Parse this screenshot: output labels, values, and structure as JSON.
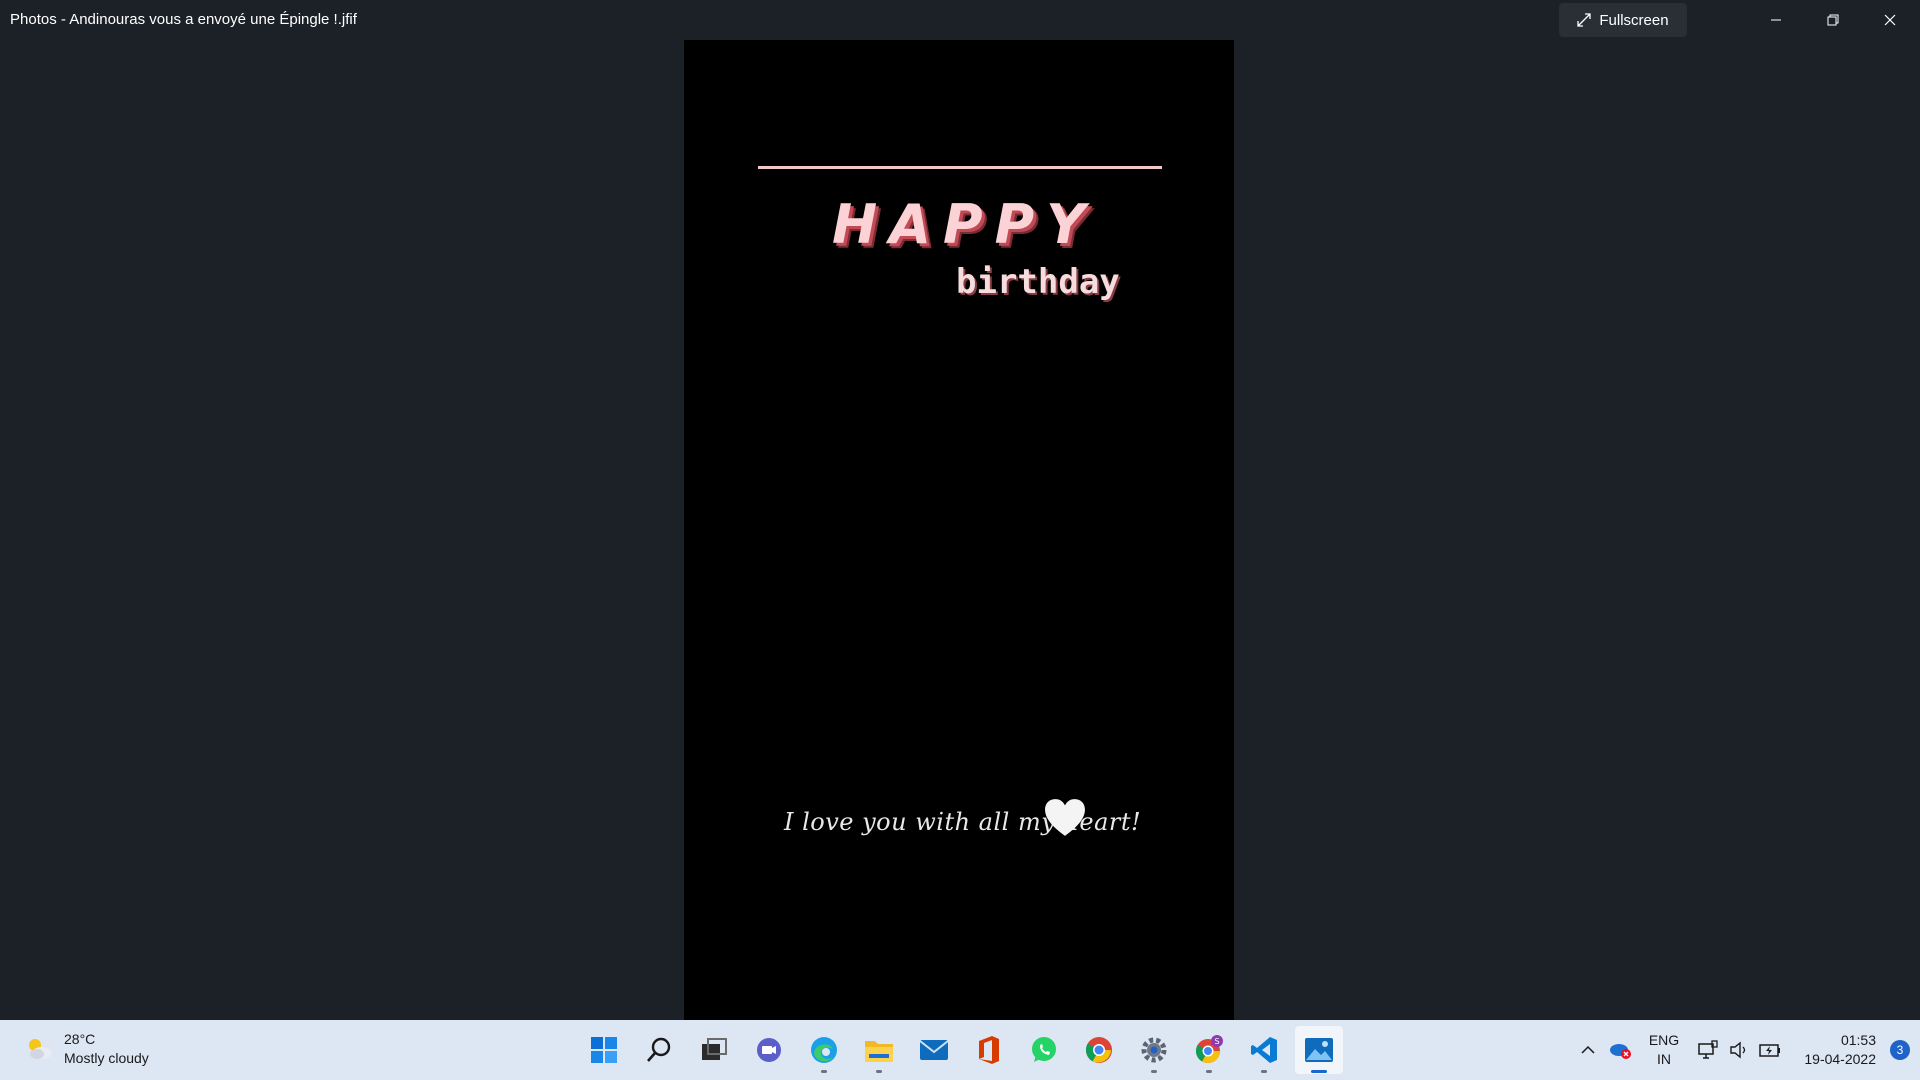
{
  "window": {
    "title": "Photos - Andinouras vous a envoyé une Épingle !.jfif",
    "fullscreen_label": "Fullscreen"
  },
  "image": {
    "happy_text": "HAPPY",
    "birthday_text": "birthday",
    "love_text": "I love you with all my heart!",
    "colors": {
      "background": "#000000",
      "accent_pink": "#fbd3d6",
      "shadow_red": "#c24a55"
    }
  },
  "taskbar": {
    "weather": {
      "temp": "28°C",
      "condition": "Mostly cloudy"
    },
    "apps": [
      {
        "name": "start",
        "icon": "windows-logo-icon",
        "running": false
      },
      {
        "name": "search",
        "icon": "search-icon",
        "running": false
      },
      {
        "name": "task-view",
        "icon": "task-view-icon",
        "running": false
      },
      {
        "name": "teams-chat",
        "icon": "video-chat-icon",
        "running": false
      },
      {
        "name": "edge",
        "icon": "edge-icon",
        "running": true
      },
      {
        "name": "file-explorer",
        "icon": "folder-icon",
        "running": true
      },
      {
        "name": "mail",
        "icon": "mail-icon",
        "running": false
      },
      {
        "name": "office",
        "icon": "office-icon",
        "running": false
      },
      {
        "name": "whatsapp",
        "icon": "whatsapp-icon",
        "running": false
      },
      {
        "name": "chrome",
        "icon": "chrome-icon",
        "running": false
      },
      {
        "name": "settings",
        "icon": "gear-icon",
        "running": true
      },
      {
        "name": "chrome-profile",
        "icon": "chrome-profile-icon",
        "running": true,
        "badge": "S"
      },
      {
        "name": "vscode",
        "icon": "vscode-icon",
        "running": true
      },
      {
        "name": "photos",
        "icon": "photos-icon",
        "running": true,
        "active": true
      }
    ],
    "tray": {
      "lang_line1": "ENG",
      "lang_line2": "IN",
      "time": "01:53",
      "date": "19-04-2022",
      "notification_count": "3"
    }
  }
}
